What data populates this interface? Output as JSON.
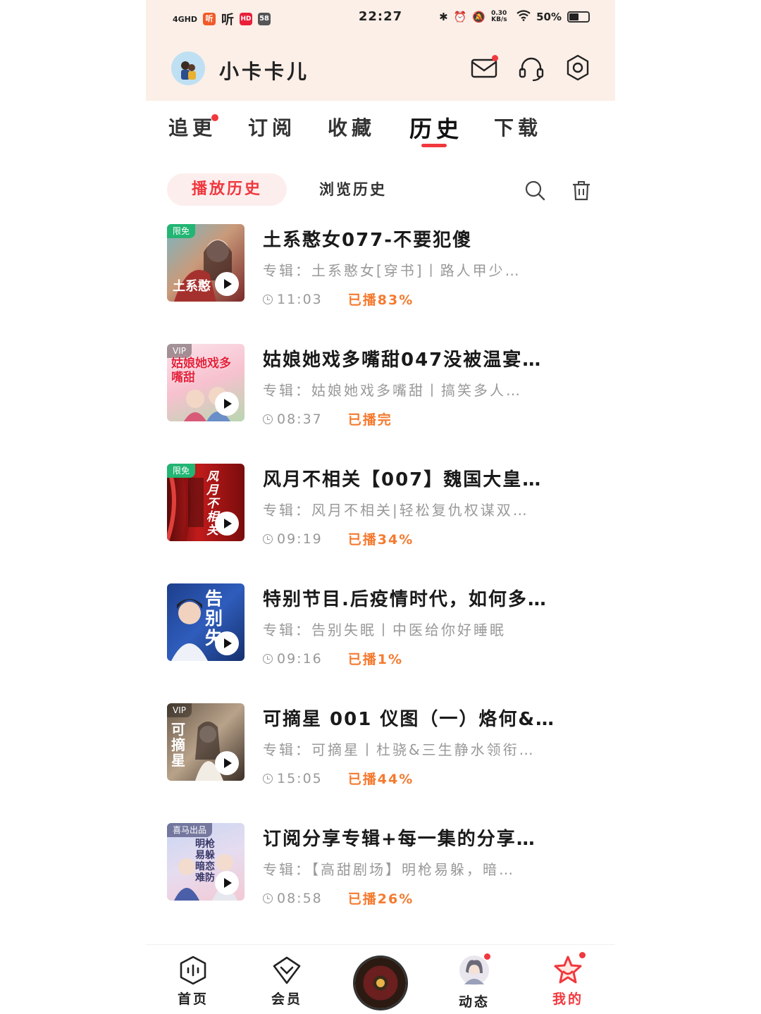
{
  "status_bar": {
    "network": "4GHD",
    "app_icons": [
      "听",
      "听",
      "HD",
      "58"
    ],
    "time": "22:27",
    "speed": "0.30 KB/s",
    "battery": "50%",
    "battery_level": 0.5
  },
  "header": {
    "username": "小卡卡儿",
    "icons": [
      "mail-icon",
      "headphones-icon",
      "settings-icon"
    ]
  },
  "tabs": [
    {
      "label": "追更",
      "has_dot": true
    },
    {
      "label": "订阅"
    },
    {
      "label": "收藏"
    },
    {
      "label": "历史",
      "active": true
    },
    {
      "label": "下载"
    }
  ],
  "subtabs": {
    "play_history": "播放历史",
    "browse_history": "浏览历史"
  },
  "items": [
    {
      "title": "土系憨女077-不要犯傻",
      "album": "专辑：土系憨女[穿书]丨路人甲少…",
      "duration": "11:03",
      "progress": "已播83%",
      "badge": "限免",
      "cover_text": "土系憨"
    },
    {
      "title": "姑娘她戏多嘴甜047没被温宴…",
      "album": "专辑：姑娘她戏多嘴甜丨搞笑多人…",
      "duration": "08:37",
      "progress": "已播完",
      "badge": "VIP",
      "cover_text": "姑娘她戏多嘴甜"
    },
    {
      "title": "风月不相关【007】魏国大皇…",
      "album": "专辑：风月不相关|轻松复仇权谋双…",
      "duration": "09:19",
      "progress": "已播34%",
      "badge": "限免",
      "cover_text": "风月不相关"
    },
    {
      "title": "特别节目.后疫情时代，如何多…",
      "album": "专辑：告别失眠丨中医给你好睡眠",
      "duration": "09:16",
      "progress": "已播1%",
      "badge": "",
      "cover_text": "告别失"
    },
    {
      "title": "可摘星 001 仪图（一）烙何&…",
      "album": "专辑：可摘星丨杜骁&三生静水领衔…",
      "duration": "15:05",
      "progress": "已播44%",
      "badge": "VIP",
      "cover_text": "可摘星"
    },
    {
      "title": "订阅分享专辑+每一集的分享…",
      "album": "专辑：【高甜剧场】明枪易躲，暗…",
      "duration": "08:58",
      "progress": "已播26%",
      "badge": "喜马出品",
      "cover_text": "明枪易躲暗恋难防"
    }
  ],
  "bottom_nav": [
    {
      "label": "首页",
      "icon": "home-icon"
    },
    {
      "label": "会员",
      "icon": "vip-icon"
    },
    {
      "label": "",
      "icon": "player-disc-icon"
    },
    {
      "label": "动态",
      "icon": "feed-avatar-icon"
    },
    {
      "label": "我的",
      "icon": "profile-icon",
      "active": true
    }
  ],
  "colors": {
    "accent": "#f0383e",
    "progress": "#f57a2f",
    "header_bg": "#fcefe8"
  }
}
